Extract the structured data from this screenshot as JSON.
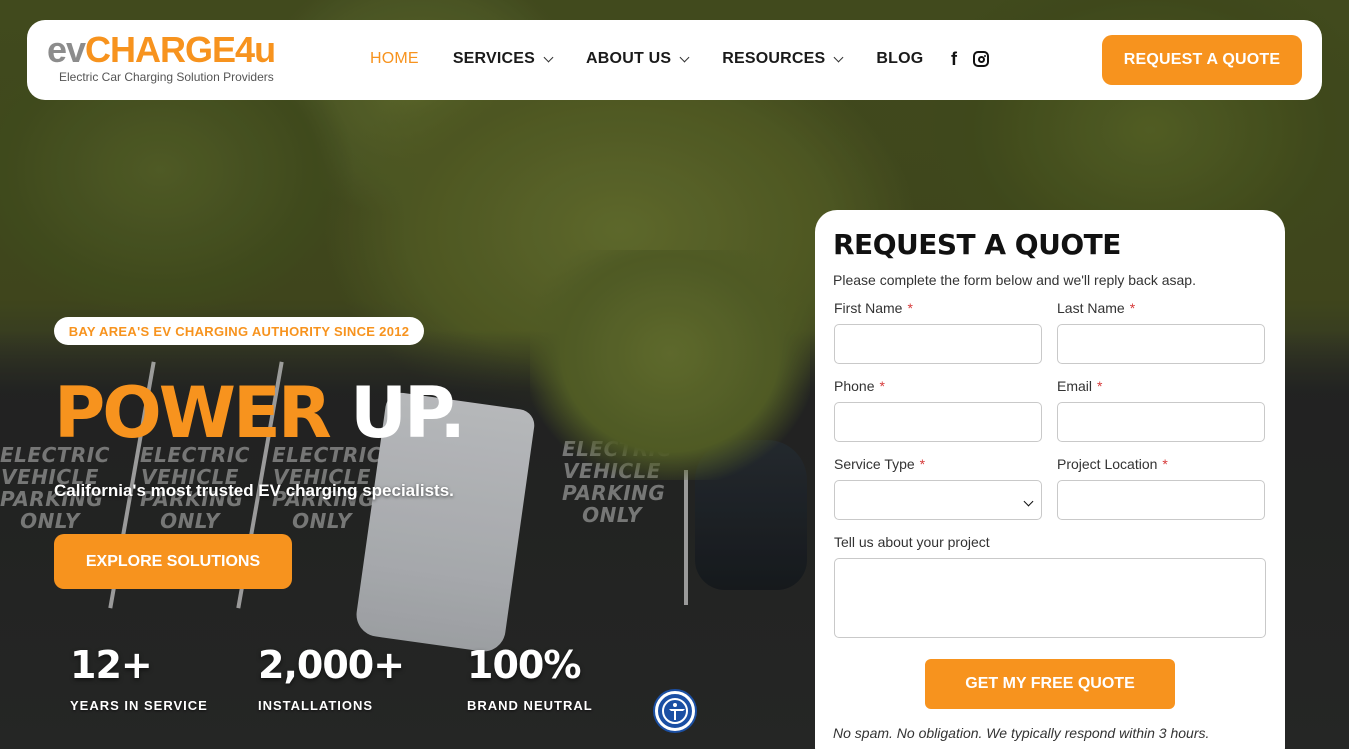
{
  "colors": {
    "accent": "#f7931e",
    "header_bg": "#ffffff",
    "required": "#d63a3a",
    "accessibility_blue": "#1b4fa3"
  },
  "logo": {
    "ev": "ev",
    "charge": "CHARGE4u",
    "tagline": "Electric Car Charging Solution Providers"
  },
  "nav": {
    "items": [
      {
        "label": "HOME",
        "active": true
      },
      {
        "label": "SERVICES",
        "dropdown": true
      },
      {
        "label": "ABOUT US",
        "dropdown": true
      },
      {
        "label": "RESOURCES",
        "dropdown": true
      },
      {
        "label": "BLOG"
      }
    ],
    "social": {
      "facebook": "f",
      "instagram": "instagram-icon"
    },
    "cta": "REQUEST A QUOTE"
  },
  "hero": {
    "badge": "BAY AREA'S EV CHARGING AUTHORITY SINCE 2012",
    "headline_part1": "POWER",
    "headline_part2": "UP.",
    "subhead": "California's most trusted EV charging specialists.",
    "cta": "EXPLORE SOLUTIONS",
    "stats": [
      {
        "value": "12+",
        "label": "YEARS IN SERVICE"
      },
      {
        "value": "2,000+",
        "label": "INSTALLATIONS"
      },
      {
        "value": "100%",
        "label": "BRAND NEUTRAL"
      }
    ],
    "pavement_text": [
      "ELECTRIC VEHICLE PARKING ONLY"
    ]
  },
  "form": {
    "title": "REQUEST A QUOTE",
    "intro": "Please complete the form below and we'll reply back asap.",
    "fields": {
      "first_name": {
        "label": "First Name",
        "required": "*",
        "value": ""
      },
      "last_name": {
        "label": "Last Name",
        "required": "*",
        "value": ""
      },
      "phone": {
        "label": "Phone",
        "required": "*",
        "value": ""
      },
      "email": {
        "label": "Email",
        "required": "*",
        "value": ""
      },
      "service_type": {
        "label": "Service Type",
        "required": "*",
        "selected": ""
      },
      "project_location": {
        "label": "Project Location",
        "required": "*",
        "value": ""
      },
      "project": {
        "label": "Tell us about your project",
        "value": ""
      }
    },
    "submit": "GET MY FREE QUOTE",
    "note": "No spam. No obligation. We typically respond within 3 hours."
  }
}
